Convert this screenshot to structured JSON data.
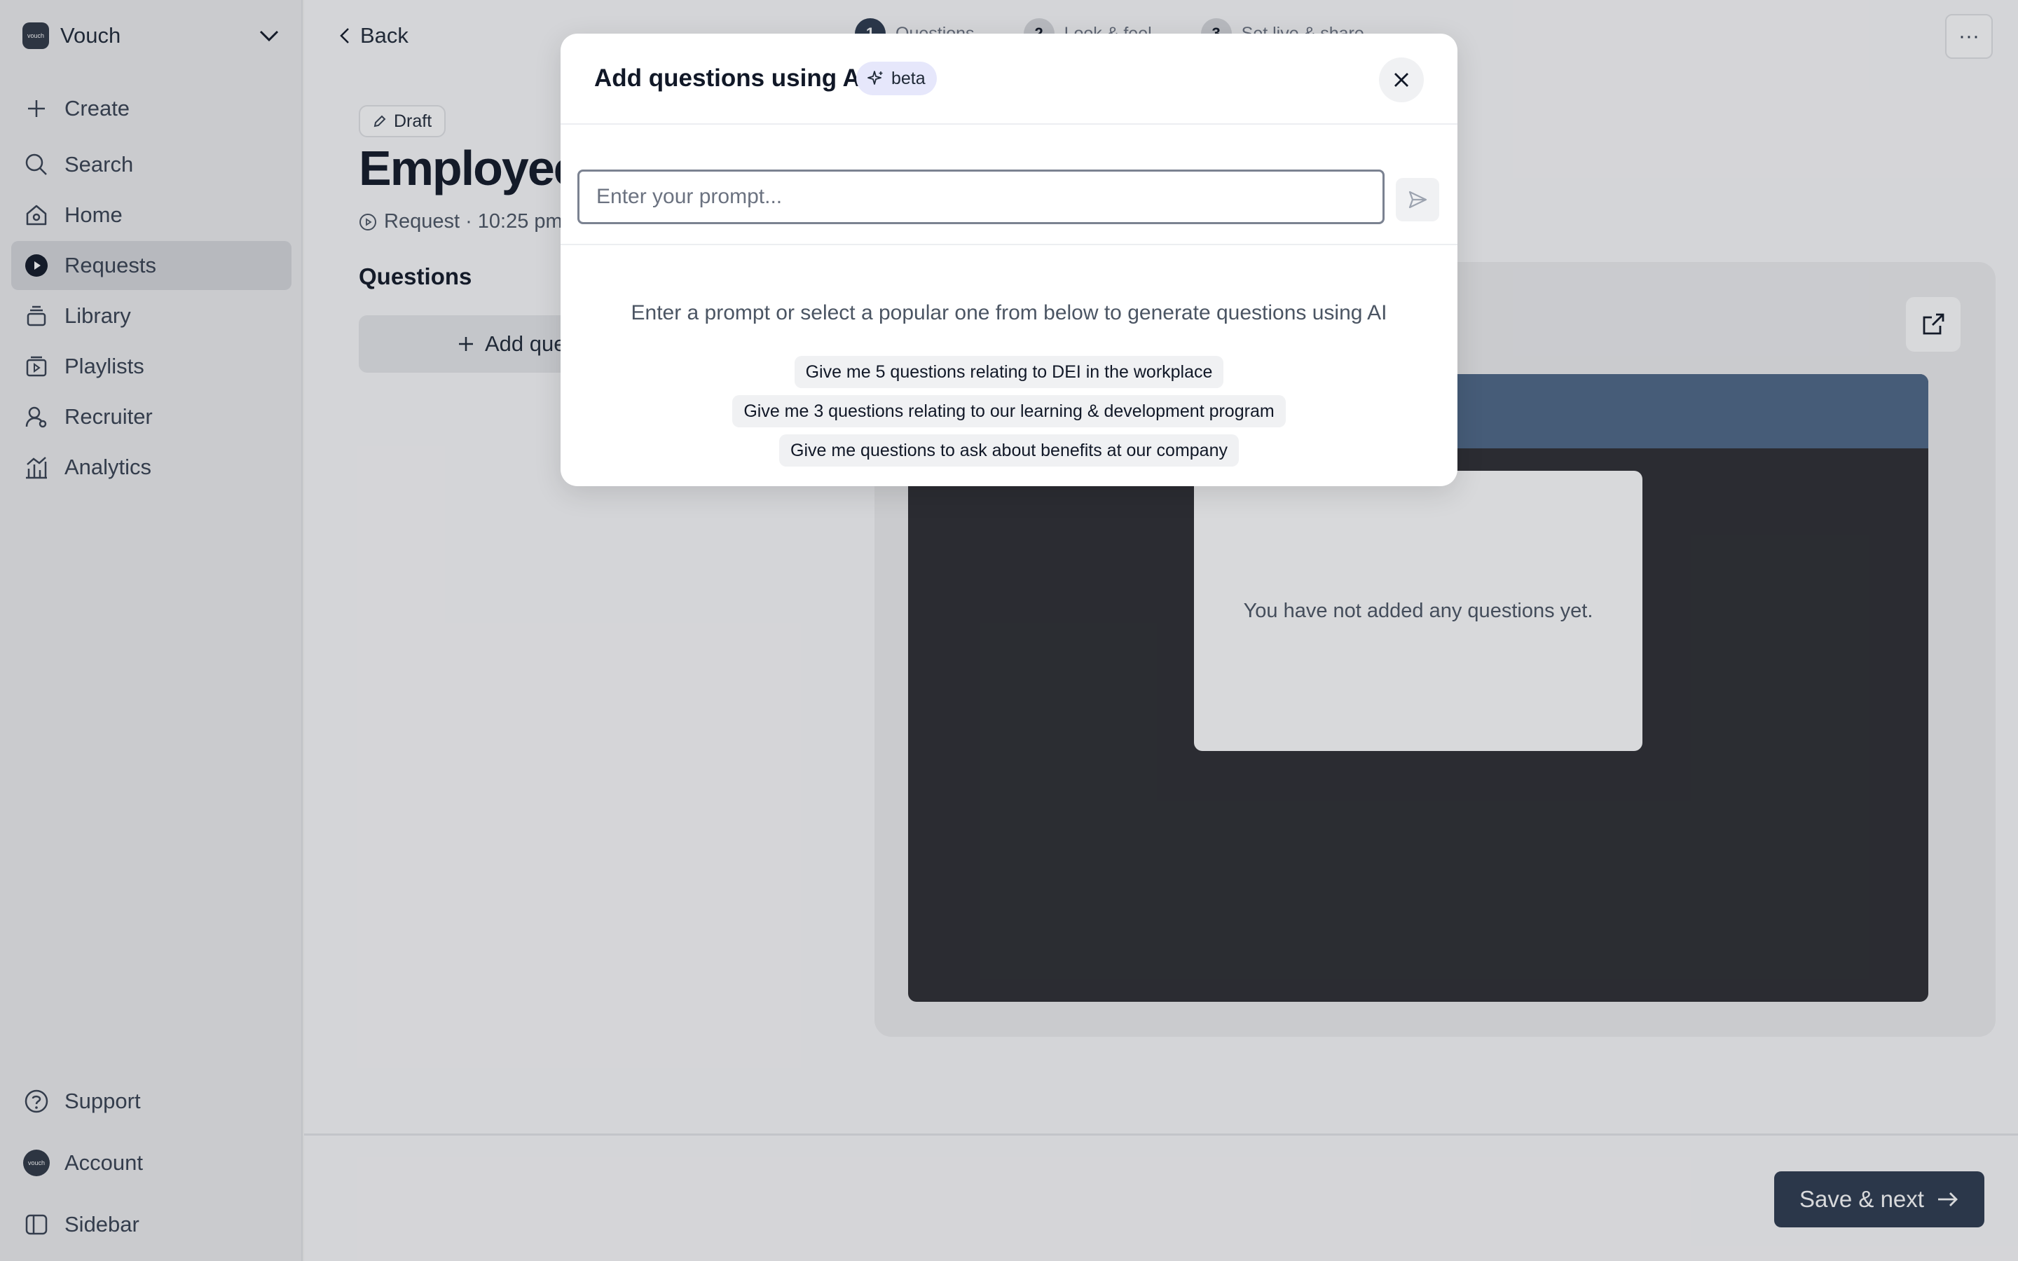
{
  "workspace": {
    "logo_text": "vouch",
    "name": "Vouch"
  },
  "sidebar": {
    "items": [
      {
        "label": "Create",
        "icon": "plus-icon"
      },
      {
        "label": "Search",
        "icon": "search-icon"
      },
      {
        "label": "Home",
        "icon": "home-icon"
      },
      {
        "label": "Requests",
        "icon": "requests-icon",
        "active": true
      },
      {
        "label": "Library",
        "icon": "library-icon"
      },
      {
        "label": "Playlists",
        "icon": "playlists-icon"
      },
      {
        "label": "Recruiter",
        "icon": "recruiter-icon"
      },
      {
        "label": "Analytics",
        "icon": "analytics-icon"
      }
    ],
    "bottom": [
      {
        "label": "Support",
        "icon": "help-icon"
      },
      {
        "label": "Account",
        "icon": "avatar"
      },
      {
        "label": "Sidebar",
        "icon": "sidebar-toggle-icon"
      }
    ]
  },
  "header": {
    "back_label": "Back",
    "steps": [
      {
        "num": "1",
        "label": "Questions",
        "active": true
      },
      {
        "num": "2",
        "label": "Look & feel"
      },
      {
        "num": "3",
        "label": "Set live & share"
      }
    ],
    "more_label": "···"
  },
  "editor": {
    "status_badge": "Draft",
    "title": "Employee S",
    "meta": "Request · 10:25 pm",
    "section_title": "Questions",
    "add_question_label": "Add que"
  },
  "preview": {
    "empty_text": "You have not added any questions yet."
  },
  "footer": {
    "save_label": "Save & next"
  },
  "modal": {
    "title": "Add questions using AI",
    "badge": "beta",
    "prompt_placeholder": "Enter your prompt...",
    "hint": "Enter a prompt or select a popular one from below to generate questions using AI",
    "suggestions": [
      "Give me 5 questions relating to DEI in the workplace",
      "Give me 3 questions relating to our learning & development program",
      "Give me questions to ask about benefits at our company"
    ]
  },
  "colors": {
    "primary": "#2d3a4f",
    "preview_header": "#4d6787",
    "preview_body": "#2c2d31",
    "beta_badge": "#e6e7fb"
  }
}
